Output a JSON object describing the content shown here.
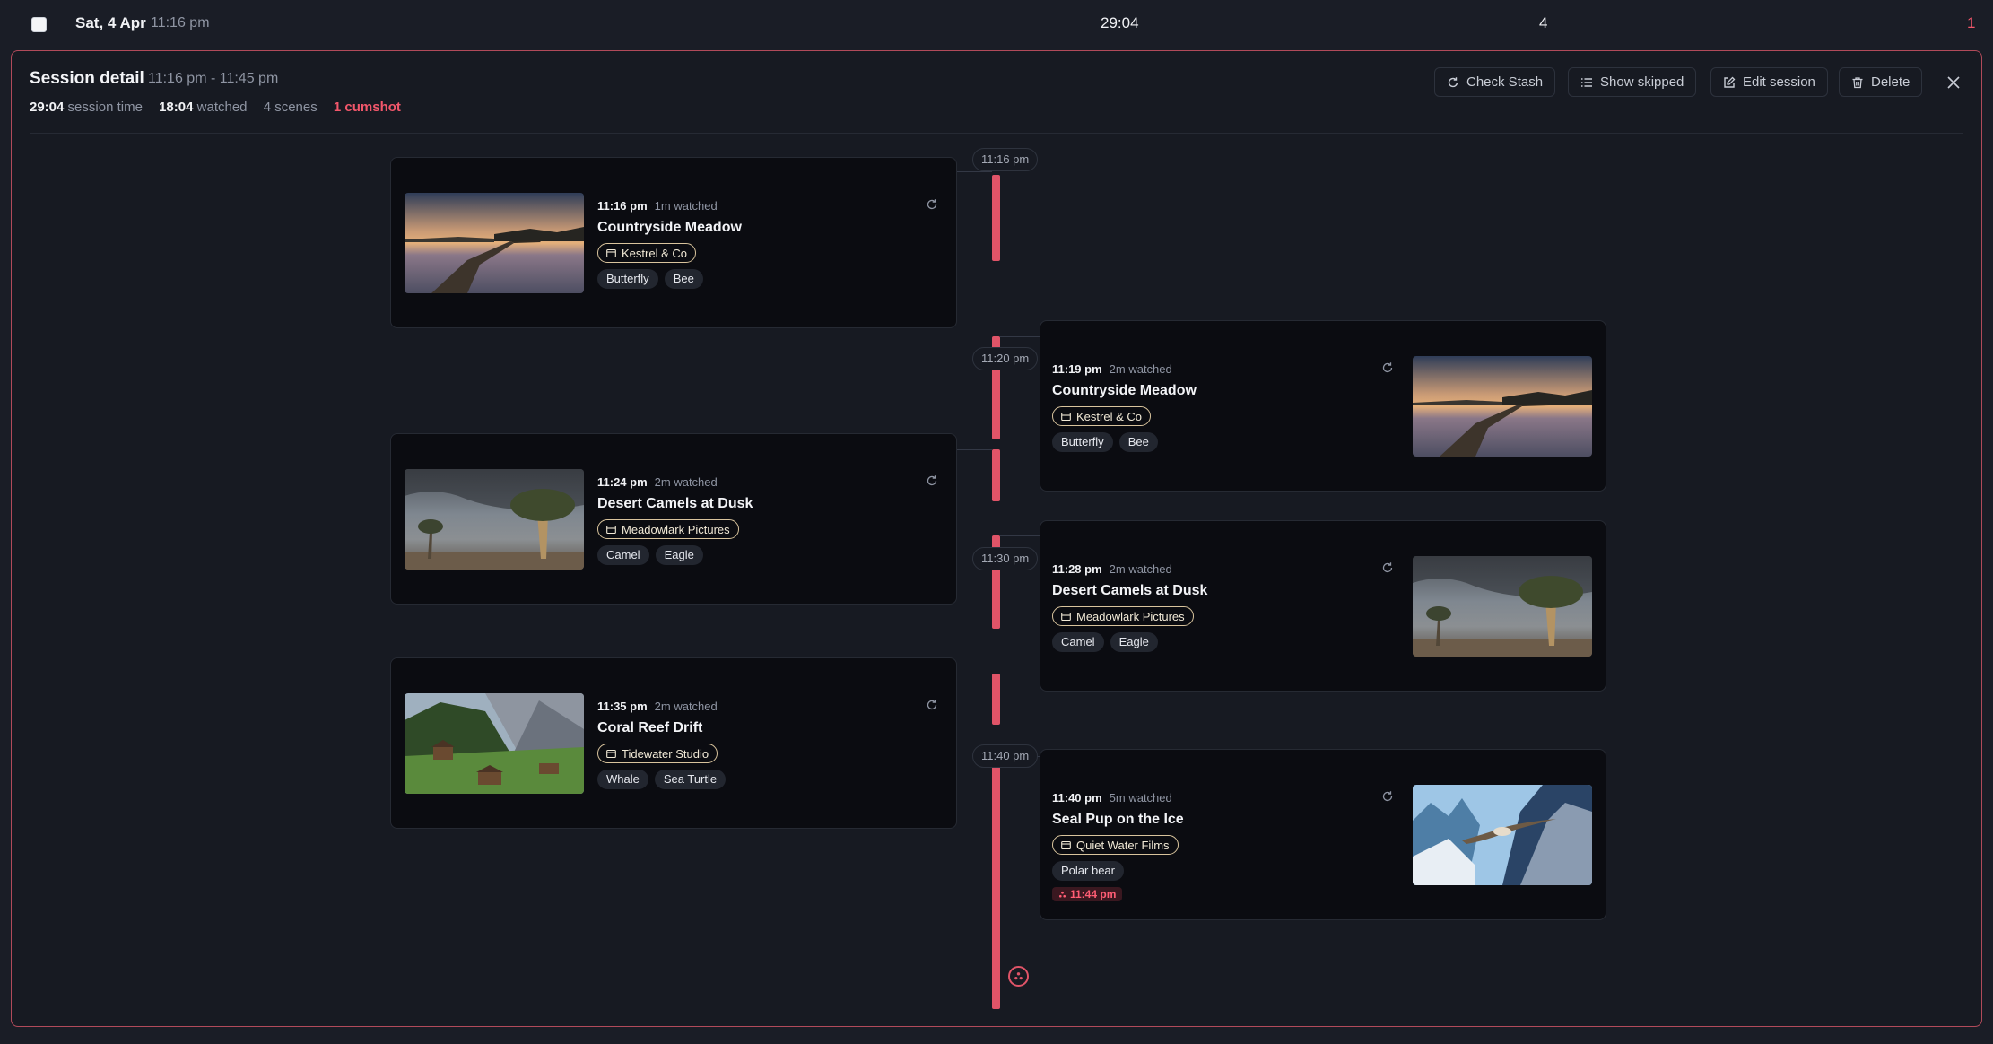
{
  "top_row": {
    "date": "Sat, 4 Apr",
    "time": "11:16 pm",
    "duration": "29:04",
    "scenes": "4",
    "count": "1"
  },
  "panel": {
    "title": "Session detail",
    "range": "11:16 pm - 11:45 pm",
    "stats": {
      "session_time_value": "29:04",
      "session_time_label": "session time",
      "watched_value": "18:04",
      "watched_label": "watched",
      "scenes": "4 scenes",
      "events": "1 cumshot"
    },
    "buttons": {
      "check_stash": "Check Stash",
      "show_skipped": "Show skipped",
      "edit_session": "Edit session",
      "delete": "Delete"
    }
  },
  "timeline": {
    "accent_color": "#e05468",
    "time_markers": [
      "11:16 pm",
      "11:20 pm",
      "11:30 pm",
      "11:40 pm"
    ],
    "entries": [
      {
        "side": "left",
        "time": "11:16 pm",
        "watched": "1m watched",
        "title": "Countryside Meadow",
        "studio": "Kestrel & Co",
        "tags": [
          "Butterfly",
          "Bee"
        ],
        "thumbnail": "lake-pier"
      },
      {
        "side": "right",
        "time": "11:19 pm",
        "watched": "2m watched",
        "title": "Countryside Meadow",
        "studio": "Kestrel & Co",
        "tags": [
          "Butterfly",
          "Bee"
        ],
        "thumbnail": "lake-pier"
      },
      {
        "side": "left",
        "time": "11:24 pm",
        "watched": "2m watched",
        "title": "Desert Camels at Dusk",
        "studio": "Meadowlark Pictures",
        "tags": [
          "Camel",
          "Eagle"
        ],
        "thumbnail": "quiver-tree"
      },
      {
        "side": "right",
        "time": "11:28 pm",
        "watched": "2m watched",
        "title": "Desert Camels at Dusk",
        "studio": "Meadowlark Pictures",
        "tags": [
          "Camel",
          "Eagle"
        ],
        "thumbnail": "quiver-tree"
      },
      {
        "side": "left",
        "time": "11:35 pm",
        "watched": "2m watched",
        "title": "Coral Reef Drift",
        "studio": "Tidewater Studio",
        "tags": [
          "Whale",
          "Sea Turtle"
        ],
        "thumbnail": "alpine-village"
      },
      {
        "side": "right",
        "time": "11:40 pm",
        "watched": "5m watched",
        "title": "Seal Pup on the Ice",
        "studio": "Quiet Water Films",
        "tags": [
          "Polar bear"
        ],
        "event_time": "11:44 pm",
        "thumbnail": "mountain-bird"
      }
    ]
  }
}
